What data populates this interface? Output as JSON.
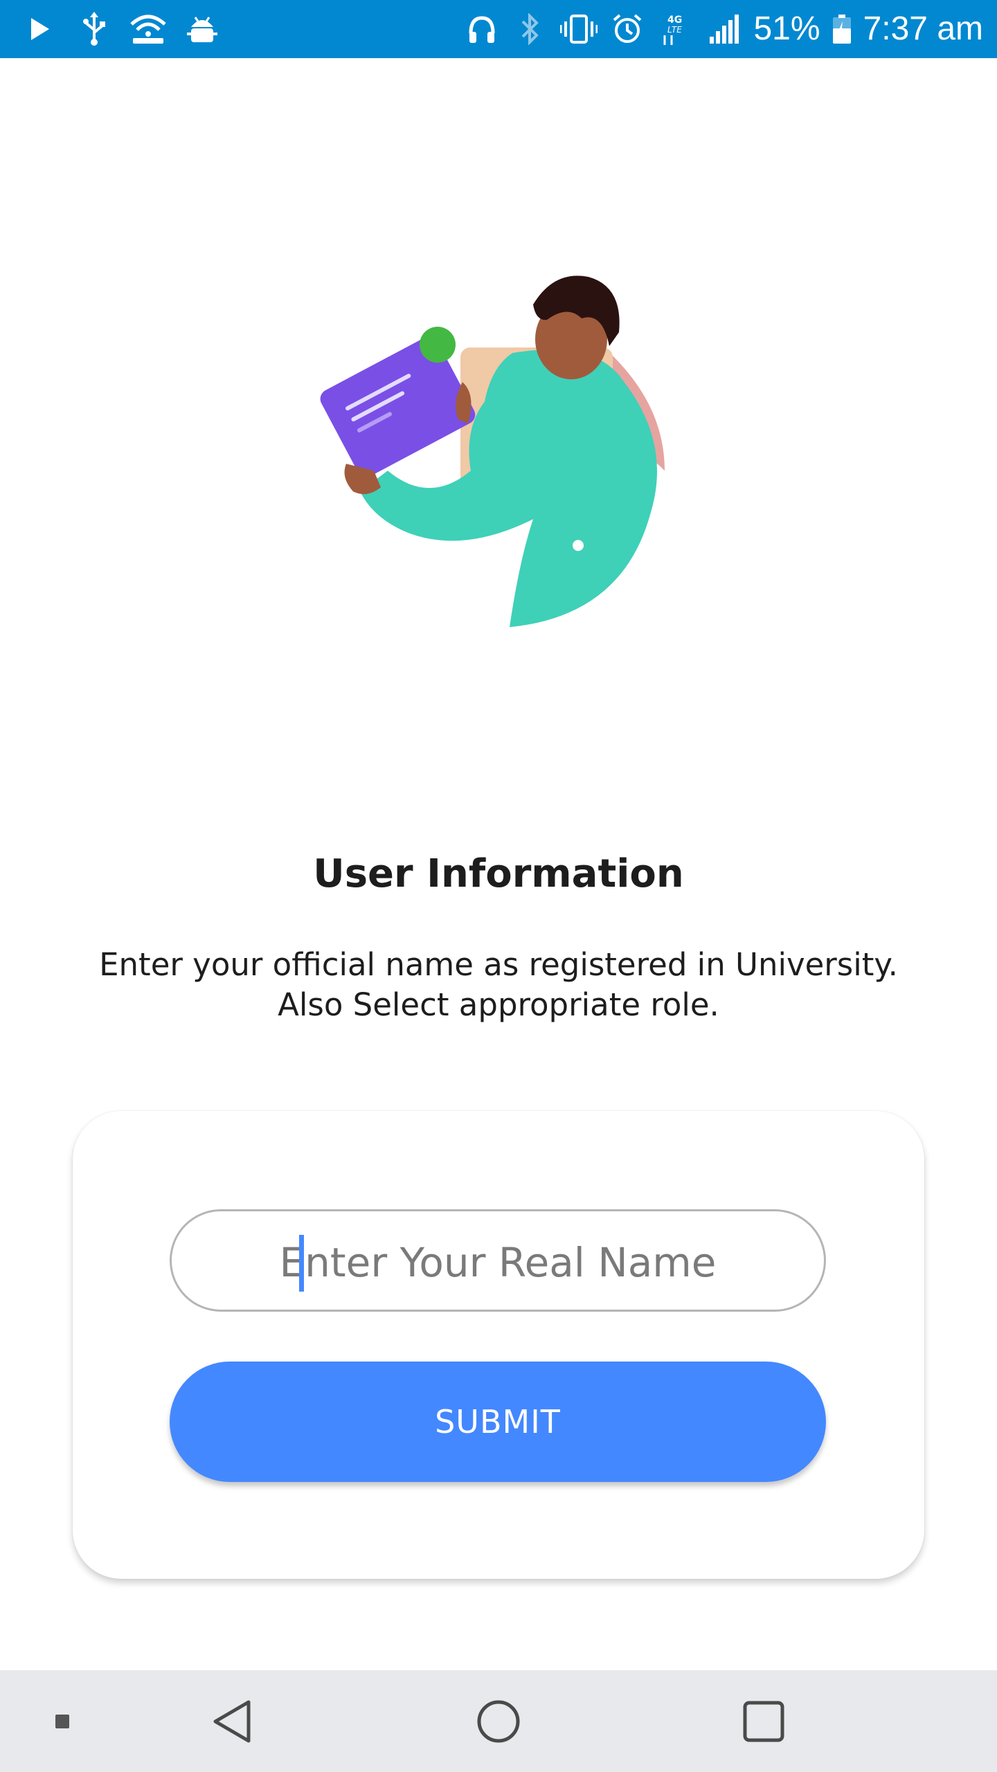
{
  "status_bar": {
    "left_icons": [
      "play-icon",
      "usb-icon",
      "wifi-hotspot-icon",
      "android-debug-icon"
    ],
    "right_icons": [
      "headphones-icon",
      "bluetooth-icon",
      "vibrate-icon",
      "alarm-icon",
      "4g-lte-icon",
      "signal-icon",
      "battery-icon"
    ],
    "battery": "51%",
    "time": "7:37 am",
    "color": "#0288d1"
  },
  "main": {
    "title": "User Information",
    "subtitle_line1": "Enter your official name as registered in University.",
    "subtitle_line2": "Also Select appropriate role."
  },
  "form": {
    "name_value": "",
    "name_placeholder": "Enter Your Real Name",
    "submit_label": "SUBMIT",
    "accent": "#4488ff"
  },
  "navbar": {
    "icons": [
      "recents-dot-icon",
      "back-icon",
      "home-icon",
      "overview-icon"
    ]
  }
}
